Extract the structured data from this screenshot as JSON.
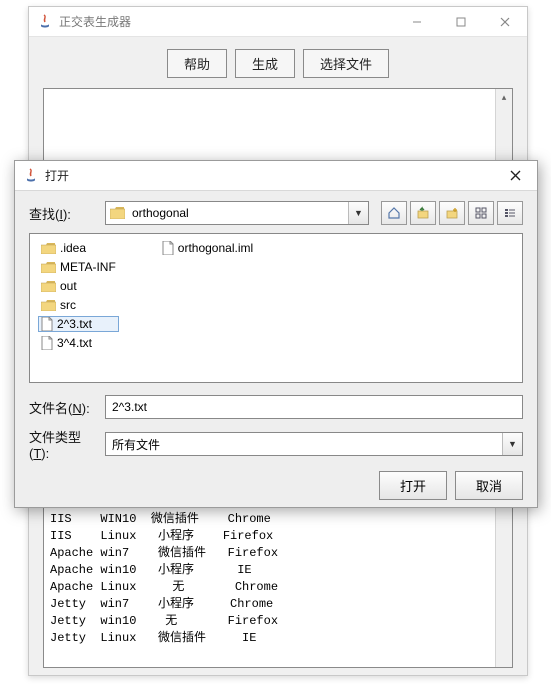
{
  "main_window": {
    "title": "正交表生成器",
    "toolbar": {
      "help": "帮助",
      "generate": "生成",
      "choose_file": "选择文件"
    },
    "textarea_visible": "IIS    WIN10  微信插件    Chrome\nIIS    Linux   小程序    Firefox\nApache win7    微信插件   Firefox\nApache win10   小程序      IE\nApache Linux     无       Chrome\nJetty  win7    小程序     Chrome\nJetty  win10    无       Firefox\nJetty  Linux   微信插件     IE"
  },
  "dialog": {
    "title": "打开",
    "lookin_label_a": "查找(",
    "lookin_label_u": "I",
    "lookin_label_b": "):",
    "lookin_value": "orthogonal",
    "nav_icons": [
      "home-icon",
      "up-icon",
      "new-folder-icon",
      "list-view-icon",
      "details-view-icon"
    ],
    "files_col1": [
      {
        "name": ".idea",
        "type": "folder",
        "selected": false
      },
      {
        "name": "META-INF",
        "type": "folder",
        "selected": false
      },
      {
        "name": "out",
        "type": "folder",
        "selected": false
      },
      {
        "name": "src",
        "type": "folder",
        "selected": false
      },
      {
        "name": "2^3.txt",
        "type": "file",
        "selected": true
      },
      {
        "name": "3^4.txt",
        "type": "file",
        "selected": false
      }
    ],
    "files_col2": [
      {
        "name": "orthogonal.iml",
        "type": "file",
        "selected": false
      }
    ],
    "filename_label_a": "文件名(",
    "filename_label_u": "N",
    "filename_label_b": "):",
    "filename_value": "2^3.txt",
    "filetype_label_a": "文件类型(",
    "filetype_label_u": "T",
    "filetype_label_b": "):",
    "filetype_value": "所有文件",
    "open_btn": "打开",
    "cancel_btn": "取消"
  }
}
